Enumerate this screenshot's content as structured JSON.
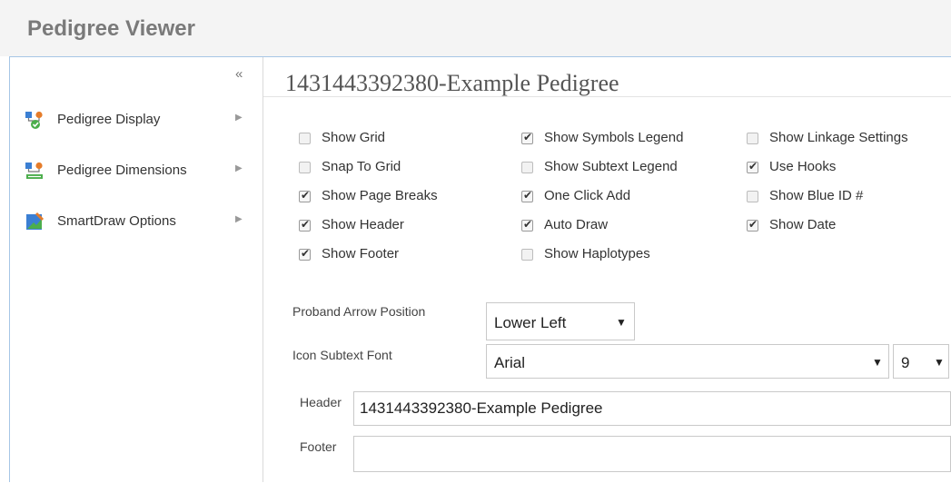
{
  "app": {
    "title": "Pedigree Viewer"
  },
  "sidebar": {
    "collapse_label": "«",
    "items": [
      {
        "label": "Pedigree Display",
        "icon": "pedigree-display-icon"
      },
      {
        "label": "Pedigree Dimensions",
        "icon": "pedigree-dimensions-icon"
      },
      {
        "label": "SmartDraw Options",
        "icon": "smartdraw-options-icon"
      }
    ]
  },
  "document": {
    "title": "1431443392380-Example Pedigree"
  },
  "options": {
    "col1": [
      {
        "label": "Show Grid",
        "checked": false
      },
      {
        "label": "Snap To Grid",
        "checked": false
      },
      {
        "label": "Show Page Breaks",
        "checked": true
      },
      {
        "label": "Show Header",
        "checked": true
      },
      {
        "label": "Show Footer",
        "checked": true
      }
    ],
    "col2": [
      {
        "label": "Show Symbols Legend",
        "checked": true
      },
      {
        "label": "Show Subtext Legend",
        "checked": false
      },
      {
        "label": "One Click Add",
        "checked": true
      },
      {
        "label": "Auto Draw",
        "checked": true
      },
      {
        "label": "Show Haplotypes",
        "checked": false
      }
    ],
    "col3": [
      {
        "label": "Show Linkage Settings",
        "checked": false
      },
      {
        "label": "Use Hooks",
        "checked": true
      },
      {
        "label": "Show Blue ID #",
        "checked": false
      },
      {
        "label": "Show Date",
        "checked": true
      }
    ]
  },
  "form": {
    "proband_arrow": {
      "label": "Proband Arrow Position",
      "value": "Lower Left"
    },
    "icon_subtext_font": {
      "label": "Icon Subtext Font",
      "value": "Arial",
      "size": "9"
    },
    "header": {
      "label": "Header",
      "value": "1431443392380-Example Pedigree"
    },
    "footer": {
      "label": "Footer",
      "value": ""
    }
  },
  "colors": {
    "highlight": "#c00000",
    "title": "#7a7a7a",
    "panel_border": "#a6c6e6"
  }
}
